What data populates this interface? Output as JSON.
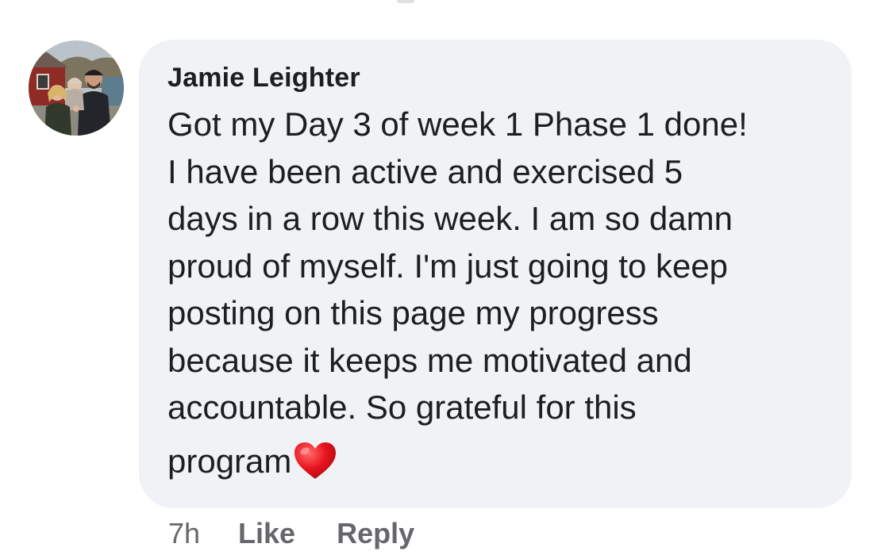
{
  "comment": {
    "author": "Jamie Leighter",
    "text_lines": [
      "Got my Day 3 of week 1 Phase 1 done!",
      "I have been active and exercised 5",
      "days in a row this week. I am so damn",
      "proud of myself. I'm just going to keep",
      "posting on this page my progress",
      "because it keeps me motivated and",
      "accountable. So grateful for this",
      "program"
    ],
    "trailing_emoji": "red-heart-emoji",
    "timestamp": "7h",
    "actions": {
      "like_label": "Like",
      "reply_label": "Reply"
    }
  },
  "colors": {
    "bubble_background": "#f0f2f5",
    "text_primary": "#1c1e21",
    "text_secondary": "#65676b",
    "heart": "#e8141e"
  },
  "icons": {
    "avatar": "profile-photo-avatar",
    "heart": "red-heart-emoji"
  }
}
